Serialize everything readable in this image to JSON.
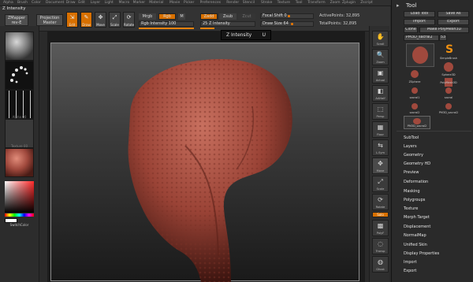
{
  "menu": [
    "Alpha",
    "Brush",
    "Color",
    "Document",
    "Draw",
    "Edit",
    "Layer",
    "Light",
    "Macro",
    "Marker",
    "Material",
    "Movie",
    "Picker",
    "Preferences",
    "Render",
    "Stencil",
    "Stroke",
    "Texture",
    "Tool",
    "Transform",
    "Zoom",
    "Zplugin",
    "Zscript"
  ],
  "title": "Z Intensity",
  "shelf": {
    "zmapper_label": "ZMapper",
    "zmapper_sub": "rev-E",
    "projection_label": "Projection",
    "projection_sub": "Master",
    "edit_label": "Edit",
    "draw_label": "Draw",
    "move_label": "Move",
    "scale_label": "Scale",
    "rotate_label": "Rotate",
    "mrgb_label": "Mrgb",
    "rgb_label": "Rgb",
    "m_label": "M",
    "rgb_intensity_label": "Rgb Intensity",
    "rgb_intensity_value": "100",
    "zadd_label": "Zadd",
    "zsub_label": "Zsub",
    "zcut_label": "Zcut",
    "z_intensity_value": "25",
    "z_intensity_label": "Z Intensity",
    "focal_shift_label": "Focal Shift",
    "focal_shift_value": "0",
    "draw_size_label": "Draw Size",
    "draw_size_value": "64",
    "active_points": "ActivePoints: 32,895",
    "total_points": "TotalPoints: 32,895"
  },
  "left_panel": {
    "thumb_captions": [
      "",
      "",
      "Alpha 00",
      "Texture 00",
      ""
    ],
    "switch_color": "SwitchColor"
  },
  "tooltip": {
    "label": "Z Intensity",
    "hotkey": "U"
  },
  "right_strip": [
    "Scroll",
    "Zoom",
    "Actual",
    "AAHalf",
    "Persp",
    "Floor",
    "L.Sym",
    "Move",
    "Scale",
    "Rotate",
    "PolyF",
    "Transp",
    "Ghost",
    "Xpose"
  ],
  "right_strip_badge": "Solo",
  "tool_panel": {
    "title": "Tool",
    "load_tool": "Load Tool",
    "save_as": "Save As",
    "import": "Import",
    "export": "Export",
    "clone": "Clone",
    "make_polymesh": "Make PolyMesh3D",
    "current_tool": "PM3D_sacral2",
    "current_value": "53",
    "items": [
      {
        "caption": "SimpleBrush"
      },
      {
        "caption": "Sphere3D"
      },
      {
        "caption": "ZSphere"
      },
      {
        "caption": "PolyMesh3D"
      },
      {
        "caption": "sacral1"
      },
      {
        "caption": "sacral"
      },
      {
        "caption": "sacral2"
      },
      {
        "caption": "PM3D_sacral2"
      },
      {
        "caption": "PM3D_sacral2"
      }
    ],
    "sections": [
      "SubTool",
      "Layers",
      "Geometry",
      "Geometry HD",
      "Preview",
      "Deformation",
      "Masking",
      "Polygroups",
      "Texture",
      "Morph Target",
      "Displacement",
      "NormalMap",
      "Unified Skin",
      "Display Properties",
      "Import",
      "Export"
    ]
  },
  "colors": {
    "accent": "#e8820c",
    "clay": "#a0493d",
    "background": "#2a2a2a"
  }
}
